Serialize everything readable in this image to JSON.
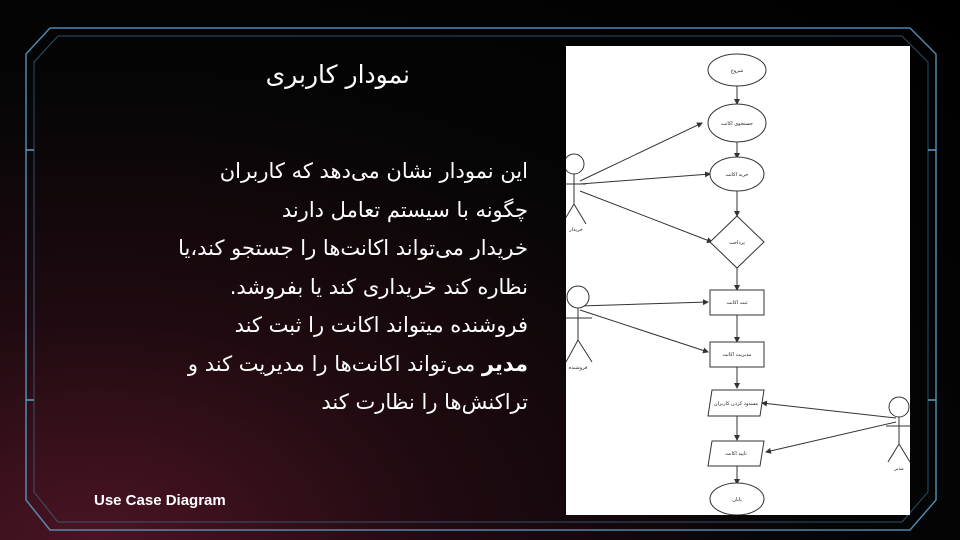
{
  "slide": {
    "title": "نمودار کاربری",
    "paragraphs": [
      "این نمودار نشان می‌دهد که کاربران",
      "چگونه با سیستم تعامل دارند",
      "خریدار می‌تواند اکانت‌ها را جستجو کند،یا",
      "نظاره کند خریداری کند یا بفروشد.",
      "فروشنده میتواند اکانت را ثبت کند"
    ],
    "admin_bold": "مدیر",
    "admin_rest": " می‌تواند اکانت‌ها را مدیریت کند و",
    "last_line": "تراکنش‌ها را نظارت کند",
    "footer": "Use Case Diagram"
  },
  "diagram": {
    "start": "شروع",
    "search": "جستجوی اکانت",
    "buy": "خرید اکانت",
    "payment": "پرداخت",
    "register": "ثبت اکانت",
    "manage": "مدیریت اکانت",
    "monitor": "مسدود کردن کاربران",
    "confirm": "تایید اکانت",
    "end": "پایان",
    "actor_buyer": "خریدار",
    "actor_seller": "فروشنده",
    "actor_admin": "مدیر"
  },
  "colors": {
    "frame": "#5a9fc9",
    "background": "#000000",
    "accent_glow": "#4a1423"
  }
}
